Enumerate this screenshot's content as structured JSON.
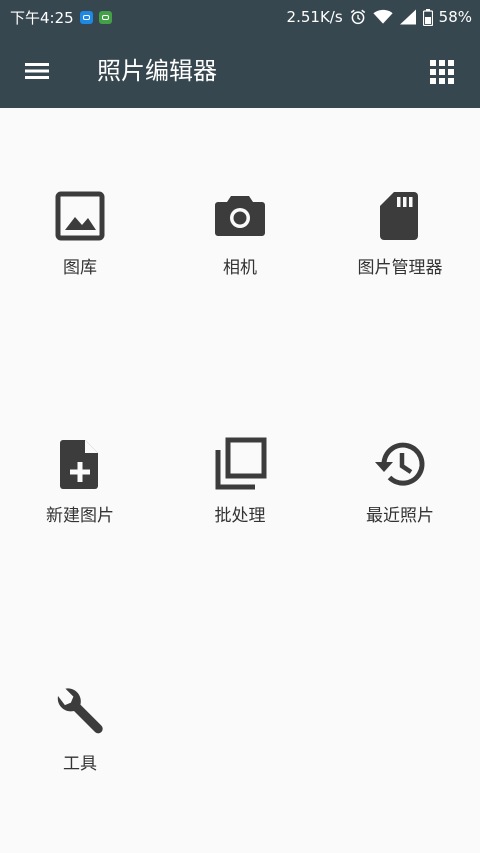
{
  "status_bar": {
    "time": "下午4:25",
    "network_speed": "2.51K/s",
    "battery": "58%",
    "icons": [
      "notification-app-icon",
      "notification-chat-icon",
      "alarm-icon",
      "wifi-icon",
      "signal-icon",
      "battery-icon"
    ]
  },
  "app_bar": {
    "title": "照片编辑器",
    "left_icon": "menu-icon",
    "right_icon": "grid-icon"
  },
  "tiles": [
    {
      "label": "图库",
      "icon": "gallery-icon"
    },
    {
      "label": "相机",
      "icon": "camera-icon"
    },
    {
      "label": "图片管理器",
      "icon": "sd-card-icon"
    },
    {
      "label": "新建图片",
      "icon": "new-file-icon"
    },
    {
      "label": "批处理",
      "icon": "batch-icon"
    },
    {
      "label": "最近照片",
      "icon": "history-icon"
    },
    {
      "label": "工具",
      "icon": "wrench-icon"
    }
  ],
  "colors": {
    "app_bar": "#37474f",
    "background": "#fafafa",
    "icon": "#3c3c3c",
    "label": "#333333"
  }
}
